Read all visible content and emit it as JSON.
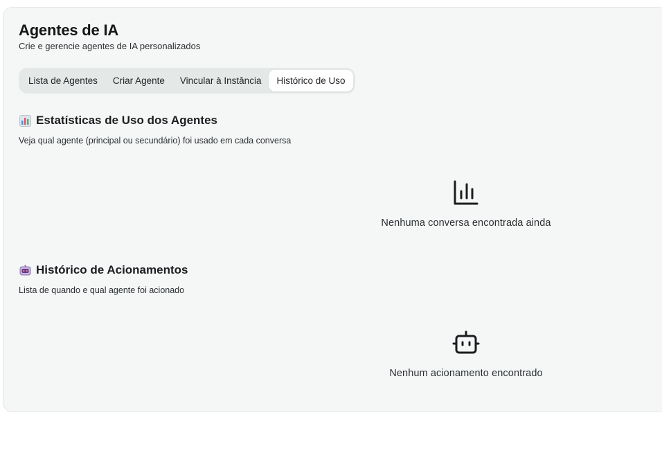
{
  "header": {
    "title": "Agentes de IA",
    "subtitle": "Crie e gerencie agentes de IA personalizados"
  },
  "tabs": [
    {
      "label": "Lista de Agentes",
      "active": false
    },
    {
      "label": "Criar Agente",
      "active": false
    },
    {
      "label": "Vincular à Instância",
      "active": false
    },
    {
      "label": "Histórico de Uso",
      "active": true
    }
  ],
  "stats_section": {
    "icon": "bar-chart-emoji-icon",
    "title": "Estatísticas de Uso dos Agentes",
    "description": "Veja qual agente (principal ou secundário) foi usado em cada conversa",
    "empty_icon": "bar-chart-icon",
    "empty_message": "Nenhuma conversa encontrada ainda"
  },
  "history_section": {
    "icon": "robot-emoji-icon",
    "title": "Histórico de Acionamentos",
    "description": "Lista de quando e qual agente foi acionado",
    "empty_icon": "bot-icon",
    "empty_message": "Nenhum acionamento encontrado"
  },
  "colors": {
    "card_background": "#f5f7f6",
    "tab_bar_background": "#e4e8e6",
    "active_tab_background": "#ffffff"
  }
}
